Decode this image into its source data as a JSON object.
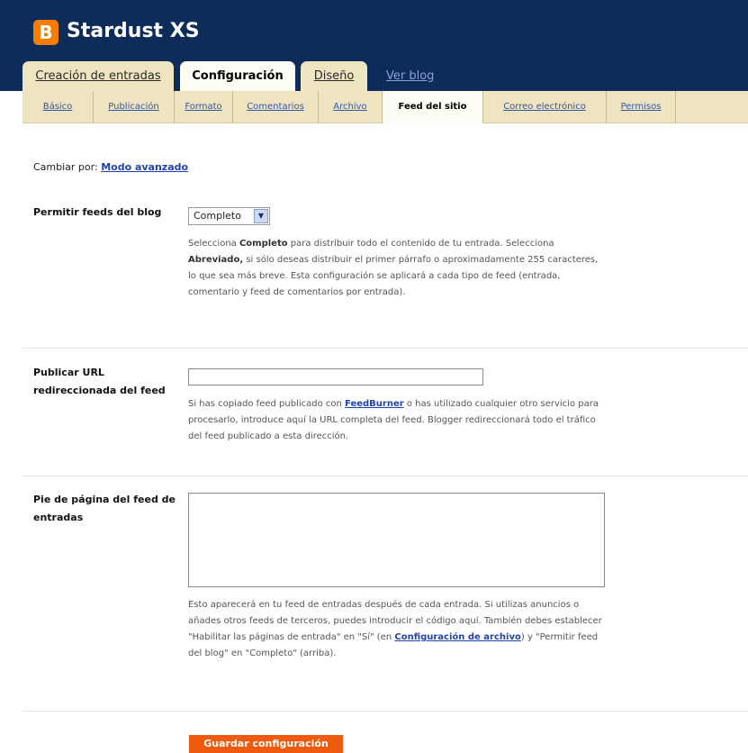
{
  "header": {
    "blog_title": "Stardust XS",
    "logo_letter": "B"
  },
  "tabs": [
    {
      "label": "Creación de entradas"
    },
    {
      "label": "Configuración"
    },
    {
      "label": "Diseño"
    },
    {
      "label": "Ver blog"
    }
  ],
  "subnav": [
    {
      "label": "Básico"
    },
    {
      "label": "Publicación"
    },
    {
      "label": "Formato"
    },
    {
      "label": "Comentarios"
    },
    {
      "label": "Archivo"
    },
    {
      "label": "Feed del sitio"
    },
    {
      "label": "Correo electrónico"
    },
    {
      "label": "Permisos"
    }
  ],
  "switch_mode": {
    "prefix": "Cambiar por:",
    "link": "Modo avanzado"
  },
  "feeds": {
    "label": "Permitir feeds del blog",
    "selected": "Completo",
    "help": {
      "p1": "Selecciona ",
      "b1": "Completo",
      "p2": " para distribuir todo el contenido de tu entrada. Selecciona ",
      "b2": "Abreviado,",
      "p3": " si sólo deseas distribuir el primer párrafo o aproximadamente 255 caracteres, lo que sea más breve. Esta configuración se aplicará a cada tipo de feed (entrada, comentario y feed de comentarios por entrada)."
    }
  },
  "redirect": {
    "label": "Publicar URL redireccionada del feed",
    "value": "",
    "help": {
      "p1": "Si has copiado feed publicado con ",
      "link": "FeedBurner",
      "p2": " o has utilizado cualquier otro servicio para procesarlo, introduce aquí la URL completa del feed. Blogger redireccionará todo el tráfico del feed publicado a esta dirección."
    }
  },
  "footer_feed": {
    "label": "Pie de página del feed de entradas",
    "value": "",
    "help": {
      "p1": "Esto aparecerá en tu feed de entradas después de cada entrada. Si utilizas anuncios o añades otros feeds de terceros, puedes introducir el código aquí. También debes establecer \"Habilitar las páginas de entrada\" en \"Sí\" (en ",
      "link": "Configuración de archivo",
      "p2": ") y \"Permitir feed del blog\" en \"Completo\" (arriba)."
    }
  },
  "save_label": "Guardar configuración",
  "colors": {
    "header_bg": "#0e2c5a",
    "tab_bg": "#efe4c0",
    "accent_orange": "#f05a10",
    "link_blue": "#2244aa"
  }
}
